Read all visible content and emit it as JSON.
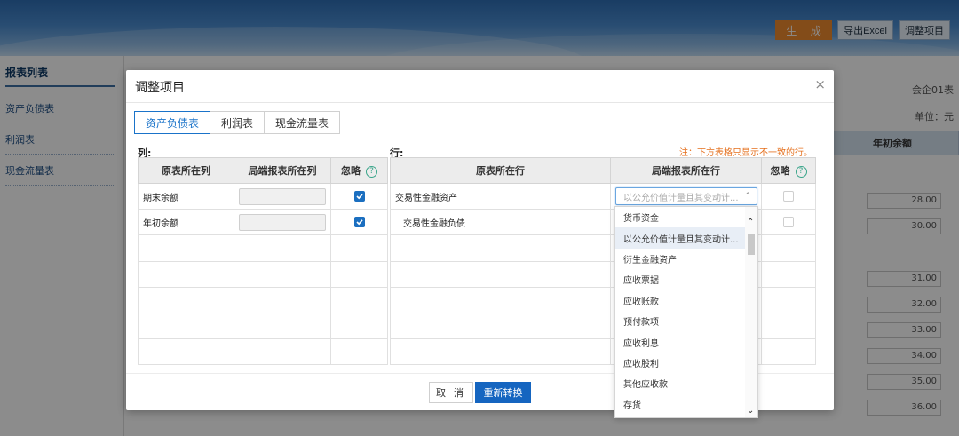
{
  "toolbar": {
    "generate_label": "生 成",
    "export_label": "导出Excel",
    "adjust_label": "调整项目"
  },
  "sidebar": {
    "header": "报表列表",
    "items": [
      {
        "label": "资产负债表"
      },
      {
        "label": "利润表"
      },
      {
        "label": "现金流量表"
      }
    ]
  },
  "background": {
    "company_code": "会企01表",
    "unit": "单位：元",
    "column_header": "年初余额",
    "values": [
      "28.00",
      "30.00",
      "31.00",
      "32.00",
      "33.00",
      "34.00",
      "35.00",
      "36.00"
    ]
  },
  "modal": {
    "title": "调整项目",
    "close_glyph": "×",
    "tabs": [
      {
        "label": "资产负债表"
      },
      {
        "label": "利润表"
      },
      {
        "label": "现金流量表"
      }
    ],
    "columns_section": {
      "label": "列:",
      "headers": {
        "source": "原表所在列",
        "target": "局端报表所在列",
        "ignore": "忽略"
      },
      "rows": [
        {
          "source": "期末余额"
        },
        {
          "source": "年初余额"
        }
      ]
    },
    "rows_section": {
      "label": "行:",
      "note": "注：下方表格只显示不一致的行。",
      "headers": {
        "source": "原表所在行",
        "target": "局端报表所在行",
        "ignore": "忽略"
      },
      "rows": [
        {
          "source": "交易性金融资产"
        },
        {
          "source": "交易性金融负债"
        }
      ],
      "select_value": "以公允价值计量且其变动计...",
      "dropdown_options": [
        {
          "label": "货币资金"
        },
        {
          "label": "以公允价值计量且其变动计..."
        },
        {
          "label": "衍生金融资产"
        },
        {
          "label": "应收票据"
        },
        {
          "label": "应收账款"
        },
        {
          "label": "预付款项"
        },
        {
          "label": "应收利息"
        },
        {
          "label": "应收股利"
        },
        {
          "label": "其他应收款"
        },
        {
          "label": "存货"
        }
      ]
    },
    "buttons": {
      "cancel": "取 消",
      "reconvert": "重新转换"
    }
  }
}
